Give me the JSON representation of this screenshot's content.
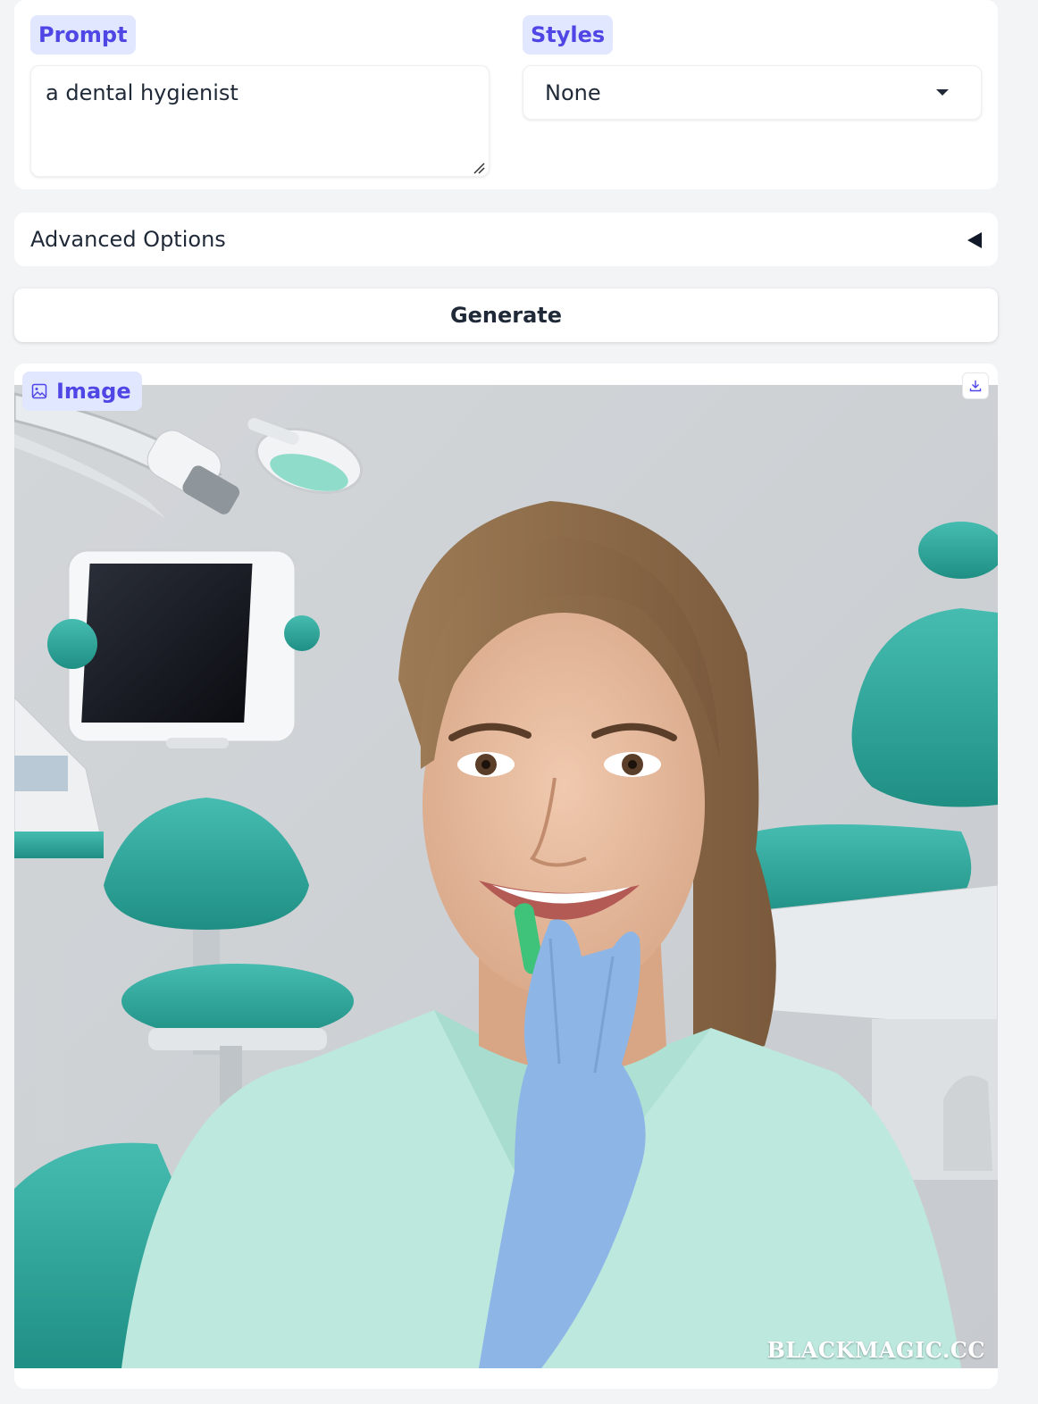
{
  "prompt": {
    "label": "Prompt",
    "value": "a dental hygienist"
  },
  "styles": {
    "label": "Styles",
    "selected": "None"
  },
  "advanced": {
    "label": "Advanced Options"
  },
  "generate": {
    "label": "Generate"
  },
  "output": {
    "label": "Image",
    "watermark": "BLACKMAGIC.CC"
  },
  "colors": {
    "accent": "#4f46e5",
    "chip_bg": "#e0e7ff",
    "page_bg": "#f3f4f6",
    "teal": "#2aa69a",
    "glove": "#8db6e6",
    "scrubs": "#b6e6dd"
  },
  "icons": {
    "image_label": "image-icon",
    "download": "download-icon",
    "accordion": "triangle-left-icon",
    "select": "caret-down-icon",
    "resize": "resize-handle-icon"
  }
}
